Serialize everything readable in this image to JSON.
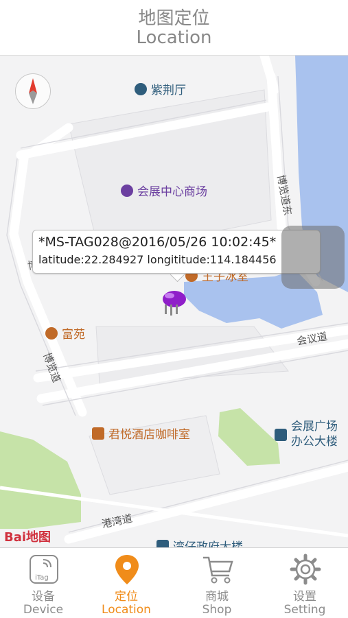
{
  "header": {
    "title_cn": "地图定位",
    "title_en": "Location"
  },
  "map": {
    "provider_logo": "Bai地图",
    "pois": [
      {
        "name": "紫荆厅",
        "icon": "museum-icon",
        "color": "#2f5d7c"
      },
      {
        "name": "会展中心商场",
        "icon": "shopping-bag-icon",
        "color": "#6b3fa0"
      },
      {
        "name": "王子冰室",
        "icon": "food-icon",
        "color": "#c06a28"
      },
      {
        "name": "富苑",
        "icon": "food-icon",
        "color": "#c06a28"
      },
      {
        "name": "君悦酒店咖啡室",
        "icon": "coffee-icon",
        "color": "#c06a28"
      },
      {
        "name": "会展广场\n办公大楼",
        "icon": "building-icon",
        "color": "#2f5d7c"
      },
      {
        "name": "湾仔政府大楼",
        "icon": "building-icon",
        "color": "#2f5d7c"
      }
    ],
    "roads": [
      "博览道东",
      "会议道",
      "博览道",
      "博览道",
      "港湾道"
    ],
    "callout": {
      "title": "*MS-TAG028@2016/05/26 10:02:45*",
      "coords": "latitude:22.284927 longititude:114.184456"
    }
  },
  "tabs": [
    {
      "cn": "设备",
      "en": "Device",
      "icon": "itag-device-icon",
      "active": false
    },
    {
      "cn": "定位",
      "en": "Location",
      "icon": "location-pin-icon",
      "active": true
    },
    {
      "cn": "商城",
      "en": "Shop",
      "icon": "shopping-cart-icon",
      "active": false
    },
    {
      "cn": "设置",
      "en": "Setting",
      "icon": "gear-icon",
      "active": false
    }
  ],
  "colors": {
    "accent": "#f08c1a",
    "inactive": "#8c8c8c",
    "water": "#a9c2ee",
    "park": "#c6e3a8"
  }
}
